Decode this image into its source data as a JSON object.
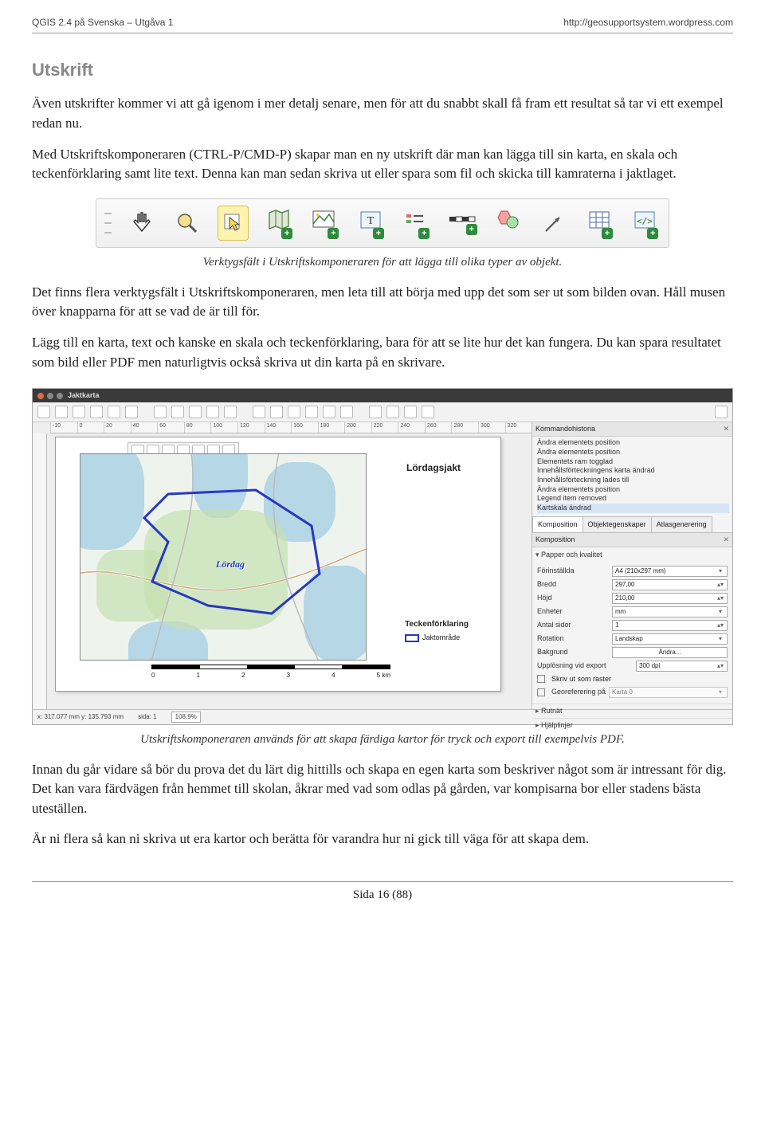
{
  "header": {
    "left": "QGIS 2.4 på Svenska – Utgåva 1",
    "right": "http://geosupportsystem.wordpress.com"
  },
  "section_title": "Utskrift",
  "para1": "Även utskrifter kommer vi att gå igenom i mer detalj senare, men för att du snabbt skall få fram ett resultat så tar vi ett exempel redan nu.",
  "para2": "Med Utskriftskomponeraren (CTRL-P/CMD-P) skapar man en ny utskrift där man kan lägga till sin karta, en skala och teckenförklaring samt lite text. Denna kan man sedan skriva ut eller spara som fil och skicka till kamraterna i jaktlaget.",
  "caption_toolbar": "Verktygsfält i Utskriftskomponeraren för att lägga till olika typer av objekt.",
  "para3": "Det finns flera verktygsfält i Utskriftskomponeraren, men leta till att börja med upp det som ser ut som bilden ovan. Håll musen över knapparna för att se vad de är till för.",
  "para4": "Lägg till en karta, text och kanske en skala och teckenförklaring, bara för att se lite hur det kan fungera. Du kan spara resultatet som bild eller PDF men naturligtvis också skriva ut din karta på en skrivare.",
  "toolbar_icons": [
    "pan-icon",
    "zoom-icon",
    "select-icon",
    "add-map-icon",
    "add-image-icon",
    "add-label-icon",
    "add-legend-icon",
    "add-scalebar-icon",
    "add-shape-icon",
    "add-arrow-icon",
    "add-table-icon",
    "add-html-icon"
  ],
  "composer": {
    "window_title": "Jaktkarta",
    "ruler_ticks": [
      "-10",
      "0",
      "20",
      "40",
      "60",
      "80",
      "100",
      "120",
      "140",
      "160",
      "180",
      "200",
      "220",
      "240",
      "260",
      "280",
      "300",
      "320"
    ],
    "map": {
      "label_inside": "Lördag",
      "title": "Lördagsjakt",
      "legend_title": "Teckenförklaring",
      "legend_item": "Jaktområde",
      "scalebar": {
        "ticks": [
          "0",
          "1",
          "2",
          "3",
          "4",
          "5 km"
        ]
      }
    },
    "history_title": "Kommandohistoria",
    "history_items": [
      "Ändra elementets position",
      "Ändra elementets position",
      "Elementets ram togglad",
      "Innehållsförteckningens karta ändrad",
      "Innehållsförteckning lades till",
      "Ändra elementets position",
      "Legend item removed",
      "Kartskala ändrad"
    ],
    "tabs": [
      "Komposition",
      "Objektegenskaper",
      "Atlasgenerering"
    ],
    "panel_title": "Komposition",
    "paper_section": "Papper och kvalitet",
    "fields": {
      "preset_label": "Förinställda",
      "preset_value": "A4 (210x297 mm)",
      "width_label": "Bredd",
      "width_value": "297,00",
      "height_label": "Höjd",
      "height_value": "210,00",
      "units_label": "Enheter",
      "units_value": "mm",
      "pages_label": "Antal sidor",
      "pages_value": "1",
      "rotation_label": "Rotation",
      "rotation_value": "Landskap",
      "background_label": "Bakgrund",
      "background_btn": "Ändra...",
      "export_res_label": "Upplösning vid export",
      "export_res_value": "300 dpi",
      "raster_label": "Skriv ut som raster",
      "georef_label": "Georeferering på",
      "georef_value": "Karta 0"
    },
    "grid_section": "Rutnät",
    "guides_section": "Hjälplinjer",
    "statusbar": {
      "coords": "x: 317.077 mm   y: 135.793 mm",
      "page": "sida: 1",
      "zoom": "108.9%"
    }
  },
  "caption_composer": "Utskriftskomponeraren används för att skapa färdiga kartor för tryck och export till exempelvis PDF.",
  "para5": "Innan du går vidare så bör du prova det du lärt dig hittills och skapa en egen karta som beskriver något som är intressant för dig. Det kan vara färdvägen från hemmet till skolan, åkrar med vad som odlas på gården, var kompisarna bor eller stadens bästa uteställen.",
  "para6": "Är ni flera så kan ni skriva ut era kartor och berätta för varandra hur ni gick till väga för att skapa dem.",
  "footer": "Sida 16 (88)"
}
